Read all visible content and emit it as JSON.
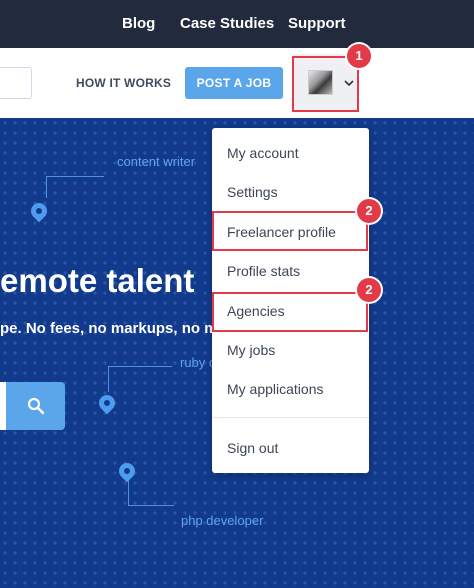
{
  "top_nav": {
    "links": [
      "Blog",
      "Case Studies",
      "Support"
    ]
  },
  "header": {
    "how_it_works": "HOW IT WORKS",
    "post_job": "POST A JOB",
    "avatar_menu_icon": "chevron-down-icon"
  },
  "hero": {
    "headline": "emote talent",
    "subline": "pe. No fees, no markups, no m",
    "tags": [
      "content writer",
      "ruby c",
      "php developer"
    ],
    "search_icon": "search-icon"
  },
  "dropdown": {
    "items": [
      "My account",
      "Settings",
      "Freelancer profile",
      "Profile stats",
      "Agencies",
      "My jobs",
      "My applications"
    ],
    "sign_out": "Sign out"
  },
  "annotations": {
    "step_1": "1",
    "step_2a": "2",
    "step_2b": "2",
    "color": "#e23a48"
  },
  "colors": {
    "topbar": "#222b3d",
    "hero": "#123a8c",
    "accent": "#5ba6ea"
  }
}
